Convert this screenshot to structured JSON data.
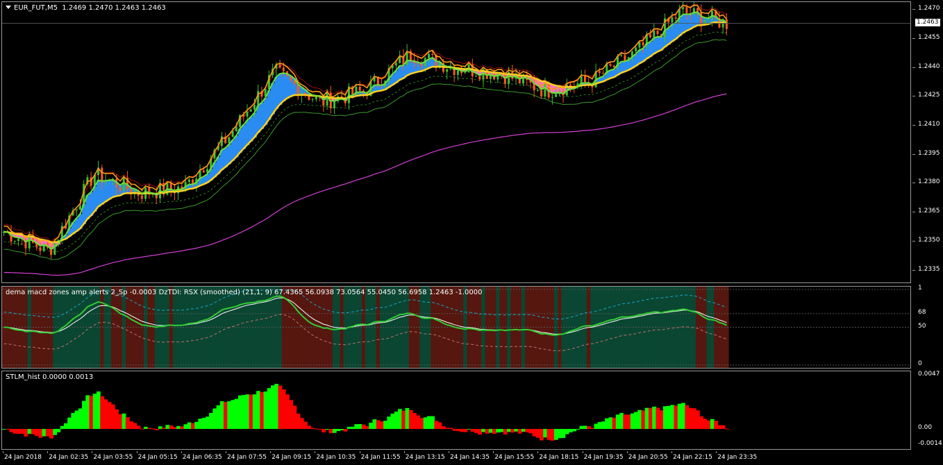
{
  "symbol_header": {
    "symbol": "EUR_FUT,M5",
    "ohlc": "1.2469 1.2470 1.2463 1.2463"
  },
  "current_price": "1.2463",
  "price_axis": {
    "labels": [
      "1.2470",
      "1.2455",
      "1.2440",
      "1.2425",
      "1.2410",
      "1.2395",
      "1.2380",
      "1.2365",
      "1.2350",
      "1.2335"
    ],
    "range": [
      1.2328,
      1.2474
    ]
  },
  "oscillator": {
    "title": "dema macd zones amp alerts 2_Sp -0.0003  DzTDI:  RSX (smoothed) (21,1, 9) 67.4365 56.0938 73.0564 55.0450 56.6958 1.2463 -1.0000",
    "axis_labels": [
      "1",
      "68",
      "50",
      "0"
    ],
    "levels": [
      100,
      68,
      50,
      0
    ]
  },
  "histogram": {
    "title": "STLM_hist 0.0000 0.0013",
    "axis_labels": [
      "0.0047",
      "0.00",
      "-0.0014"
    ],
    "range": [
      -0.0014,
      0.0047
    ]
  },
  "time_axis": {
    "labels": [
      "24 Jan 2018",
      "24 Jan 02:35",
      "24 Jan 03:55",
      "24 Jan 05:15",
      "24 Jan 06:35",
      "24 Jan 07:55",
      "24 Jan 09:15",
      "24 Jan 10:35",
      "24 Jan 11:55",
      "24 Jan 13:15",
      "24 Jan 14:35",
      "24 Jan 15:55",
      "24 Jan 18:15",
      "24 Jan 19:35",
      "24 Jan 20:55",
      "24 Jan 22:15",
      "24 Jan 23:35"
    ]
  },
  "colors": {
    "bull_candle": "#3fbf2f",
    "bear_candle": "#ff5a1e",
    "cloud_up": "#2a8cf0",
    "cloud_down": "#ff6fc2",
    "fast_ma": "#6be03a",
    "slow_ma": "#ffd21e",
    "orange_line": "#ff9b1a",
    "magenta_ma": "#d43fd4",
    "zone_bull": "#0b4a35",
    "zone_bear": "#5a1810",
    "hist_up": "#00ff00",
    "hist_down": "#ff0000"
  },
  "chart_data": {
    "type": "line",
    "x": [
      "24 Jan 2018",
      "24 Jan 02:35",
      "24 Jan 03:55",
      "24 Jan 05:15",
      "24 Jan 06:35",
      "24 Jan 07:55",
      "24 Jan 09:15",
      "24 Jan 10:35",
      "24 Jan 11:55",
      "24 Jan 13:15",
      "24 Jan 14:35",
      "24 Jan 15:55",
      "24 Jan 18:15",
      "24 Jan 19:35",
      "24 Jan 20:55",
      "24 Jan 22:15",
      "24 Jan 23:35"
    ],
    "series": [
      {
        "values": [
          1.2355,
          1.2345,
          1.2385,
          1.2375,
          1.2378,
          1.2405,
          1.2438,
          1.2422,
          1.2428,
          1.2447,
          1.244,
          1.2437,
          1.2428,
          1.2433,
          1.2448,
          1.2469,
          1.2463
        ]
      }
    ],
    "ylim": [
      1.2328,
      1.2474
    ]
  }
}
